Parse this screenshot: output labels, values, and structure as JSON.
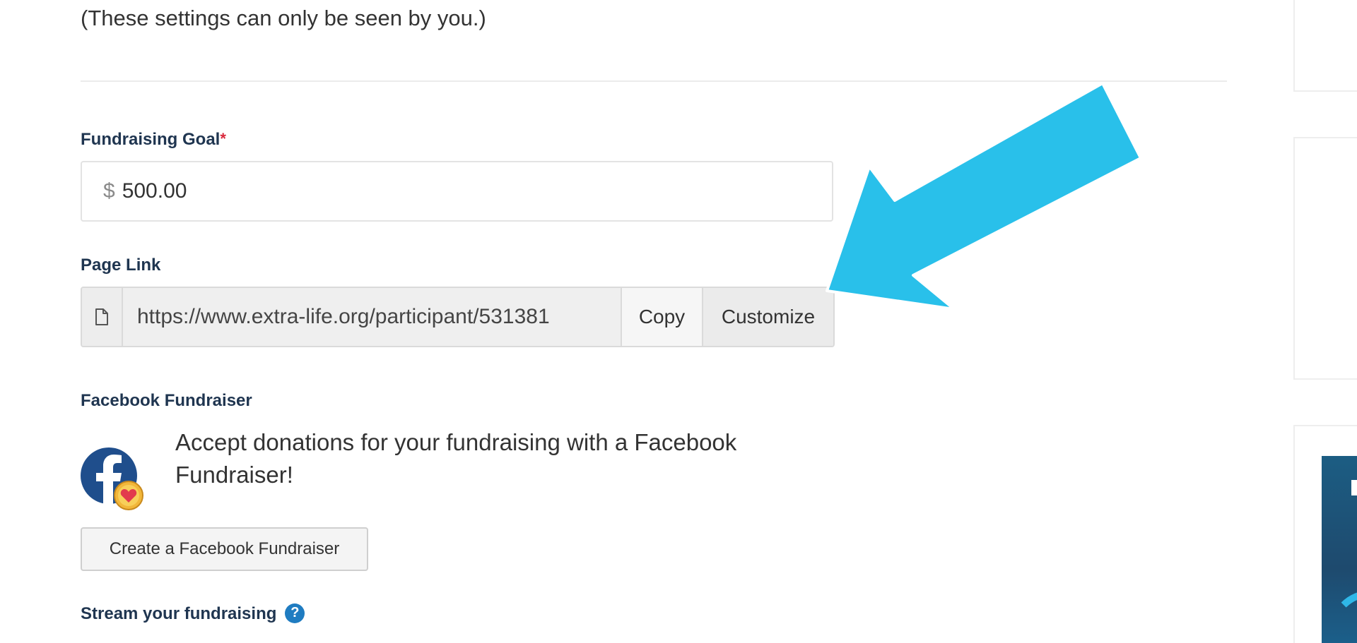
{
  "privacy_note": "(These settings can only be seen by you.)",
  "goal": {
    "label": "Fundraising Goal",
    "required_mark": "*",
    "currency": "$",
    "value": "500.00"
  },
  "page_link": {
    "label": "Page Link",
    "url": "https://www.extra-life.org/participant/531381",
    "copy_label": "Copy",
    "customize_label": "Customize"
  },
  "facebook": {
    "label": "Facebook Fundraiser",
    "description": "Accept donations for your fundraising with a Facebook Fundraiser!",
    "button_label": "Create a Facebook Fundraiser"
  },
  "stream": {
    "label": "Stream your fundraising",
    "help_glyph": "?"
  },
  "icons": {
    "link_addon": "document-icon",
    "facebook": "facebook-fundraiser-icon",
    "help": "help-icon",
    "annotation": "arrow-annotation"
  },
  "colors": {
    "accent_arrow": "#29c0ea",
    "label_text": "#1f3550",
    "required": "#d9283c",
    "facebook_blue": "#1f4e8c",
    "help_blue": "#1f7cc1"
  }
}
